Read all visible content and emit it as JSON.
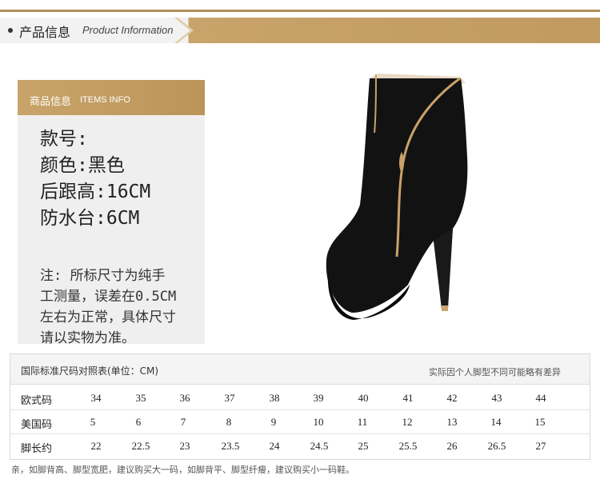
{
  "header": {
    "title_cn": "产品信息",
    "title_en": "Product Information"
  },
  "info_panel": {
    "heading_cn": "商品信息",
    "heading_en": "ITEMS INFO",
    "specs": [
      "款号:",
      "颜色:黑色",
      "后跟高:16CM",
      "防水台:6CM"
    ],
    "note_lines": [
      "注: 所标尺寸为纯手",
      "工测量，误差在0.5CM",
      "左右为正常，具体尺寸",
      "请以实物为准。"
    ]
  },
  "product_image": {
    "icon": "black-stiletto-ankle-boot",
    "colors": {
      "suede": "#101010",
      "zipper": "#c9a26a",
      "lining": "#e8d9c4"
    }
  },
  "size_table": {
    "title": "国际标准尺码对照表(单位：CM)",
    "note": "实际因个人脚型不同可能略有差异",
    "rows": [
      {
        "label": "欧式码",
        "values": [
          "34",
          "35",
          "36",
          "37",
          "38",
          "39",
          "40",
          "41",
          "42",
          "43",
          "44"
        ]
      },
      {
        "label": "美国码",
        "values": [
          "5",
          "6",
          "7",
          "8",
          "9",
          "10",
          "11",
          "12",
          "13",
          "14",
          "15"
        ]
      },
      {
        "label": "脚长约",
        "values": [
          "22",
          "22.5",
          "23",
          "23.5",
          "24",
          "24.5",
          "25",
          "25.5",
          "26",
          "26.5",
          "27"
        ]
      }
    ]
  },
  "footer_note": "亲，如脚背高、脚型宽肥，建议购买大一码，如脚背平、脚型纤瘦，建议购买小一码鞋。",
  "colors": {
    "accent_gold": "#c9a46a",
    "panel_bg": "#f0efef"
  }
}
